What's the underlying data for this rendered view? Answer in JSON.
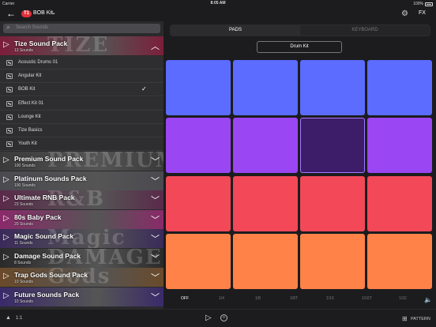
{
  "status": {
    "carrier": "Carrier",
    "time": "8:05 AM",
    "battery": "100%"
  },
  "header": {
    "badge": "T1",
    "kit_name": "BOB Kit",
    "fx_label": "FX"
  },
  "sidebar": {
    "search_placeholder": "Search Sounds",
    "open_pack": {
      "title": "Tize Sound Pack",
      "sub": "13 Sounds",
      "bg_word": "TIZE",
      "color": "#7b1f3a"
    },
    "kits": [
      {
        "label": "Acoustic Drums 01"
      },
      {
        "label": "Angular Kit"
      },
      {
        "label": "BOB Kit",
        "selected": true
      },
      {
        "label": "Effect Kit 01"
      },
      {
        "label": "Lounge Kit"
      },
      {
        "label": "Tize Basics"
      },
      {
        "label": "Youth Kit"
      }
    ],
    "packs": [
      {
        "title": "Premium Sound Pack",
        "sub": "100 Sounds",
        "bg_word": "PREMIUM",
        "color": "#3a3a3a"
      },
      {
        "title": "Platinum Sounds Pack",
        "sub": "100 Sounds",
        "bg_word": "",
        "color": "#4a4a50"
      },
      {
        "title": "Ultimate RNB Pack",
        "sub": "23 Sounds",
        "bg_word": "R&B",
        "color": "#5a2a4a"
      },
      {
        "title": "80s Baby Pack",
        "sub": "20 Sounds",
        "bg_word": "",
        "color": "#8a2a6a"
      },
      {
        "title": "Magic Sound Pack",
        "sub": "11 Sounds",
        "bg_word": "Magic",
        "color": "#3a2a5a"
      },
      {
        "title": "Damage Sound Pack",
        "sub": "8 Sounds",
        "bg_word": "DAMAGE",
        "color": "#2a2a2a"
      },
      {
        "title": "Trap Gods Sound Pack",
        "sub": "10 Sounds",
        "bg_word": "Gods",
        "color": "#6a4a2a"
      },
      {
        "title": "Future Sounds Pack",
        "sub": "10 Sounds",
        "bg_word": "",
        "color": "#3a2a6a"
      }
    ]
  },
  "main": {
    "tabs": {
      "pads": "PADS",
      "keyboard": "KEYBOARD"
    },
    "drumkit_button": "Drum Kit",
    "pad_colors": [
      "#5b6cff",
      "#5b6cff",
      "#5b6cff",
      "#5b6cff",
      "#9a46f2",
      "#9a46f2",
      "#3d1c6a",
      "#9a46f2",
      "#f24858",
      "#f24858",
      "#f24858",
      "#f24858",
      "#ff8248",
      "#ff8248",
      "#ff8248",
      "#ff8248"
    ],
    "selected_pad": 6,
    "quantize": [
      "OFF",
      "1/4",
      "1/8",
      "1/8T",
      "1/16",
      "1/16T",
      "1/32"
    ],
    "quantize_active": "OFF"
  },
  "footer": {
    "ratio": "1:1",
    "pattern_label": "PATTERN"
  }
}
